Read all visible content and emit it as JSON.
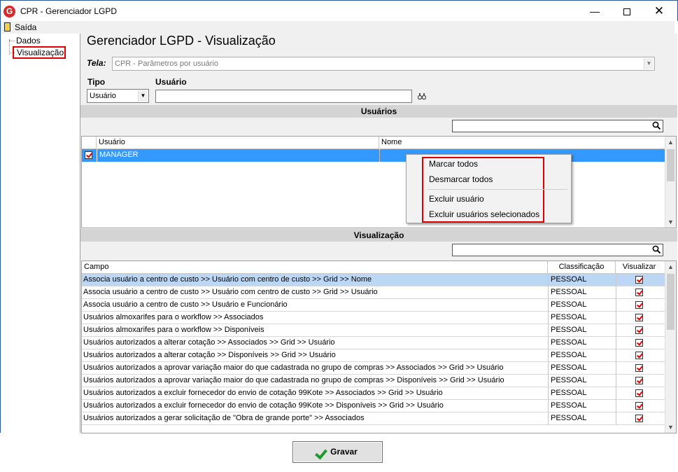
{
  "window": {
    "title": "CPR - Gerenciador LGPD",
    "minimize": "—",
    "close": "✕"
  },
  "menu": {
    "exit_label": "Saída"
  },
  "tree": {
    "items": [
      "Dados",
      "Visualização"
    ]
  },
  "page": {
    "title": "Gerenciador LGPD - Visualização",
    "tela_label": "Tela:",
    "tela_value": "CPR - Parâmetros por usuário",
    "tipo_label": "Tipo",
    "tipo_value": "Usuário",
    "usuario_label": "Usuário",
    "usuario_value": ""
  },
  "usuarios_section": {
    "header": "Usuários",
    "search_value": "",
    "columns": [
      "Usuário",
      "Nome"
    ],
    "rows": [
      {
        "checked": true,
        "usuario": "MANAGER",
        "nome": ""
      }
    ]
  },
  "context_menu": {
    "items": [
      "Marcar todos",
      "Desmarcar todos",
      "Excluir usuário",
      "Excluir usuários selecionados"
    ]
  },
  "visualizacao_section": {
    "header": "Visualização",
    "search_value": "",
    "columns": [
      "Campo",
      "Classificação",
      "Visualizar"
    ],
    "rows": [
      {
        "campo": "Associa usuário a centro de custo >> Usuário com centro de custo >> Grid >> Nome",
        "classificacao": "PESSOAL",
        "visualizar": true
      },
      {
        "campo": "Associa usuário a centro de custo >> Usuário com centro de custo >> Grid >> Usuário",
        "classificacao": "PESSOAL",
        "visualizar": true
      },
      {
        "campo": "Associa usuário a centro de custo >> Usuário e Funcionário",
        "classificacao": "PESSOAL",
        "visualizar": true
      },
      {
        "campo": "Usuários almoxarifes para o workflow >> Associados",
        "classificacao": "PESSOAL",
        "visualizar": true
      },
      {
        "campo": "Usuários almoxarifes para o workflow >> Disponíveis",
        "classificacao": "PESSOAL",
        "visualizar": true
      },
      {
        "campo": "Usuários autorizados a alterar cotação >> Associados >> Grid >> Usuário",
        "classificacao": "PESSOAL",
        "visualizar": true
      },
      {
        "campo": "Usuários autorizados a alterar cotação >> Disponíveis >> Grid >> Usuário",
        "classificacao": "PESSOAL",
        "visualizar": true
      },
      {
        "campo": "Usuários autorizados a aprovar variação maior do que cadastrada no grupo de compras >> Associados >> Grid >> Usuário",
        "classificacao": "PESSOAL",
        "visualizar": true
      },
      {
        "campo": "Usuários autorizados a aprovar variação maior do que cadastrada no grupo de compras >> Disponíveis >> Grid >> Usuário",
        "classificacao": "PESSOAL",
        "visualizar": true
      },
      {
        "campo": "Usuários autorizados a excluir fornecedor do envio de cotação 99Kote >> Associados >> Grid >> Usuário",
        "classificacao": "PESSOAL",
        "visualizar": true
      },
      {
        "campo": "Usuários autorizados a excluir fornecedor do envio de cotação 99Kote >> Disponíveis >> Grid >> Usuário",
        "classificacao": "PESSOAL",
        "visualizar": true
      },
      {
        "campo": "Usuários autorizados a gerar solicitação de \"Obra de grande porte\" >> Associados",
        "classificacao": "PESSOAL",
        "visualizar": true
      }
    ]
  },
  "save_button": {
    "label": "Gravar"
  },
  "colors": {
    "accent_red": "#e00000",
    "selection_blue": "#3399ff",
    "row_selected": "#bcd7f5",
    "check_green": "#1c9b2e"
  }
}
